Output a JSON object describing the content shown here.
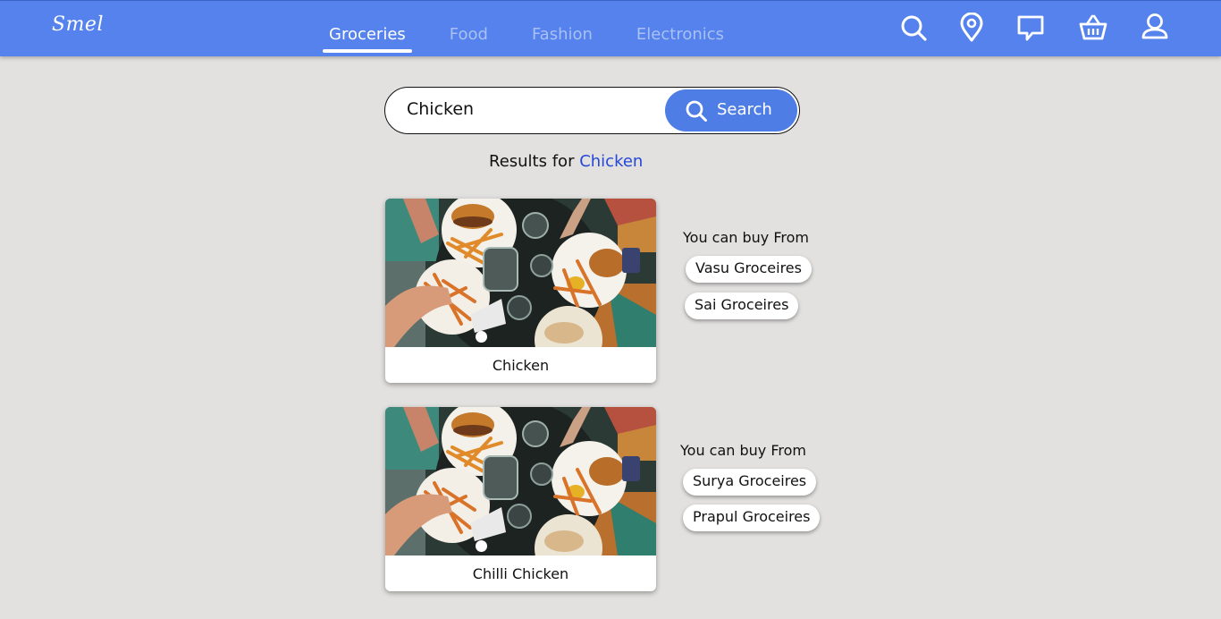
{
  "header": {
    "logo": "Smel",
    "tabs": [
      {
        "label": "Groceries",
        "active": true
      },
      {
        "label": "Food",
        "active": false
      },
      {
        "label": "Fashion",
        "active": false
      },
      {
        "label": "Electronics",
        "active": false
      }
    ],
    "icons": [
      "search-icon",
      "location-pin-icon",
      "chat-icon",
      "basket-icon",
      "user-icon"
    ]
  },
  "search": {
    "value": "Chicken",
    "button_label": "Search"
  },
  "results": {
    "prefix": "Results for",
    "term": "Chicken"
  },
  "products": [
    {
      "name": "Chicken",
      "buy_label": "You can buy From",
      "stores": [
        "Vasu Groceires",
        "Sai Groceires"
      ]
    },
    {
      "name": "Chilli Chicken",
      "buy_label": "You can buy From",
      "stores": [
        "Surya Groceires",
        "Prapul Groceires"
      ]
    }
  ],
  "colors": {
    "header_bg": "#5582ec",
    "accent": "#4f7de6",
    "result_term": "#2547d8",
    "page_bg": "#e2e1df"
  }
}
